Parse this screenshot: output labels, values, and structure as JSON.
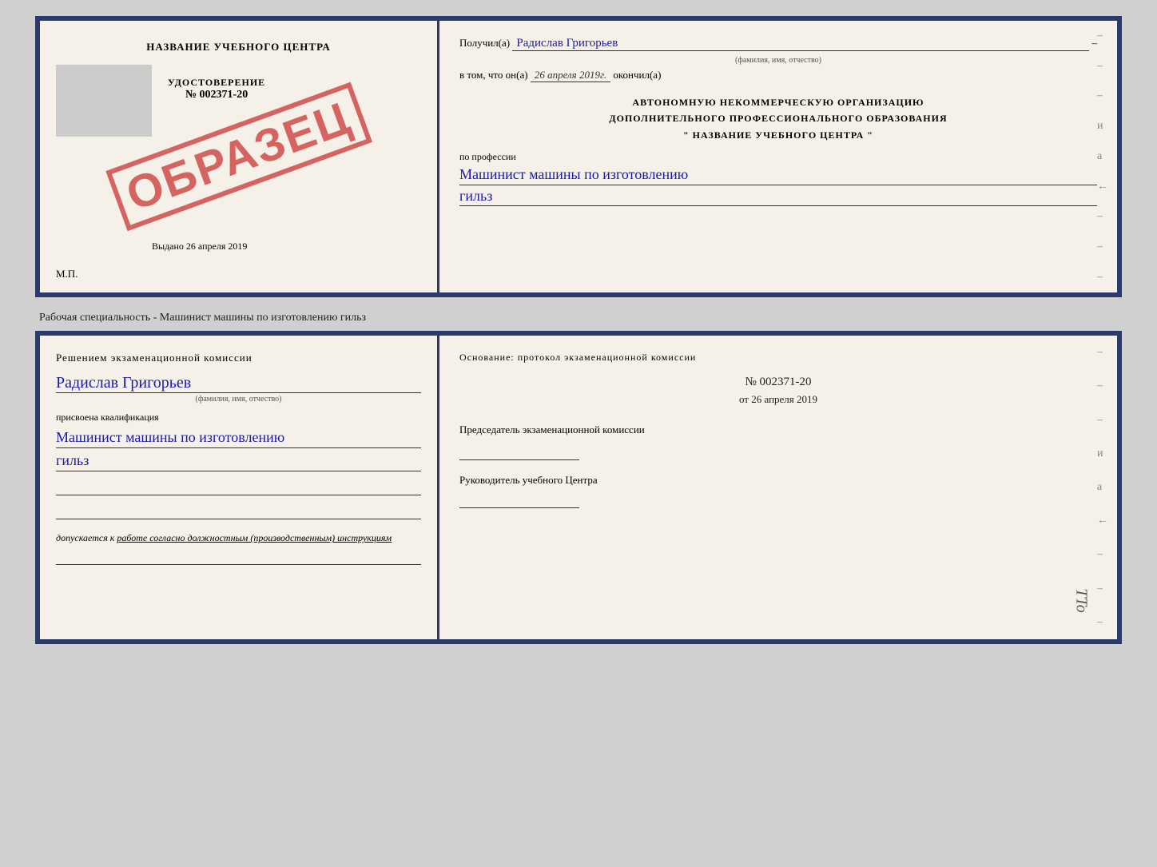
{
  "top_doc": {
    "left": {
      "center_title": "НАЗВАНИЕ УЧЕБНОГО ЦЕНТРА",
      "udostoverenie_label": "УДОСТОВЕРЕНИЕ",
      "cert_number": "№ 002371-20",
      "stamp_text": "ОБРАЗЕЦ",
      "vydano_label": "Выдано",
      "vydano_date": "26 апреля 2019",
      "mp_label": "М.П."
    },
    "right": {
      "poluchil_label": "Получил(а)",
      "fio_value": "Радислав Григорьев",
      "fio_sub": "(фамилия, имя, отчество)",
      "vtom_label": "в том, что он(а)",
      "date_value": "26 апреля 2019г.",
      "okochil_label": "окончил(а)",
      "auto_line1": "АВТОНОМНУЮ НЕКОММЕРЧЕСКУЮ ОРГАНИЗАЦИЮ",
      "auto_line2": "ДОПОЛНИТЕЛЬНОГО ПРОФЕССИОНАЛЬНОГО ОБРАЗОВАНИЯ",
      "auto_line3": "\"   НАЗВАНИЕ УЧЕБНОГО ЦЕНТРА   \"",
      "profession_label": "по профессии",
      "profession_value": "Машинист машины по изготовлению",
      "profession_value2": "гильз"
    }
  },
  "separator": {
    "text": "Рабочая специальность - Машинист машины по изготовлению гильз"
  },
  "bottom_doc": {
    "left": {
      "decision_title": "Решением  экзаменационной  комиссии",
      "fio_value": "Радислав Григорьев",
      "fio_sub": "(фамилия, имя, отчество)",
      "assigned_label": "присвоена квалификация",
      "qualification_value": "Машинист  машины  по изготовлению",
      "qualification_value2": "гильз",
      "dopuskaetsya_label": "допускается к",
      "dopuskaetsya_value": "работе согласно должностным (производственным) инструкциям"
    },
    "right": {
      "osnov_label": "Основание: протокол экзаменационной  комиссии",
      "protocol_number": "№  002371-20",
      "protocol_date_prefix": "от",
      "protocol_date": "26 апреля 2019",
      "predsed_label": "Председатель экзаменационной комиссии",
      "rukov_label": "Руководитель учебного Центра"
    }
  },
  "dashes": [
    "-",
    "-",
    "-",
    "и",
    "а",
    "←",
    "-",
    "-",
    "-"
  ],
  "dashes_bottom": [
    "-",
    "-",
    "-",
    "и",
    "а",
    "←",
    "-",
    "-",
    "-"
  ],
  "tto_text": "TTo"
}
